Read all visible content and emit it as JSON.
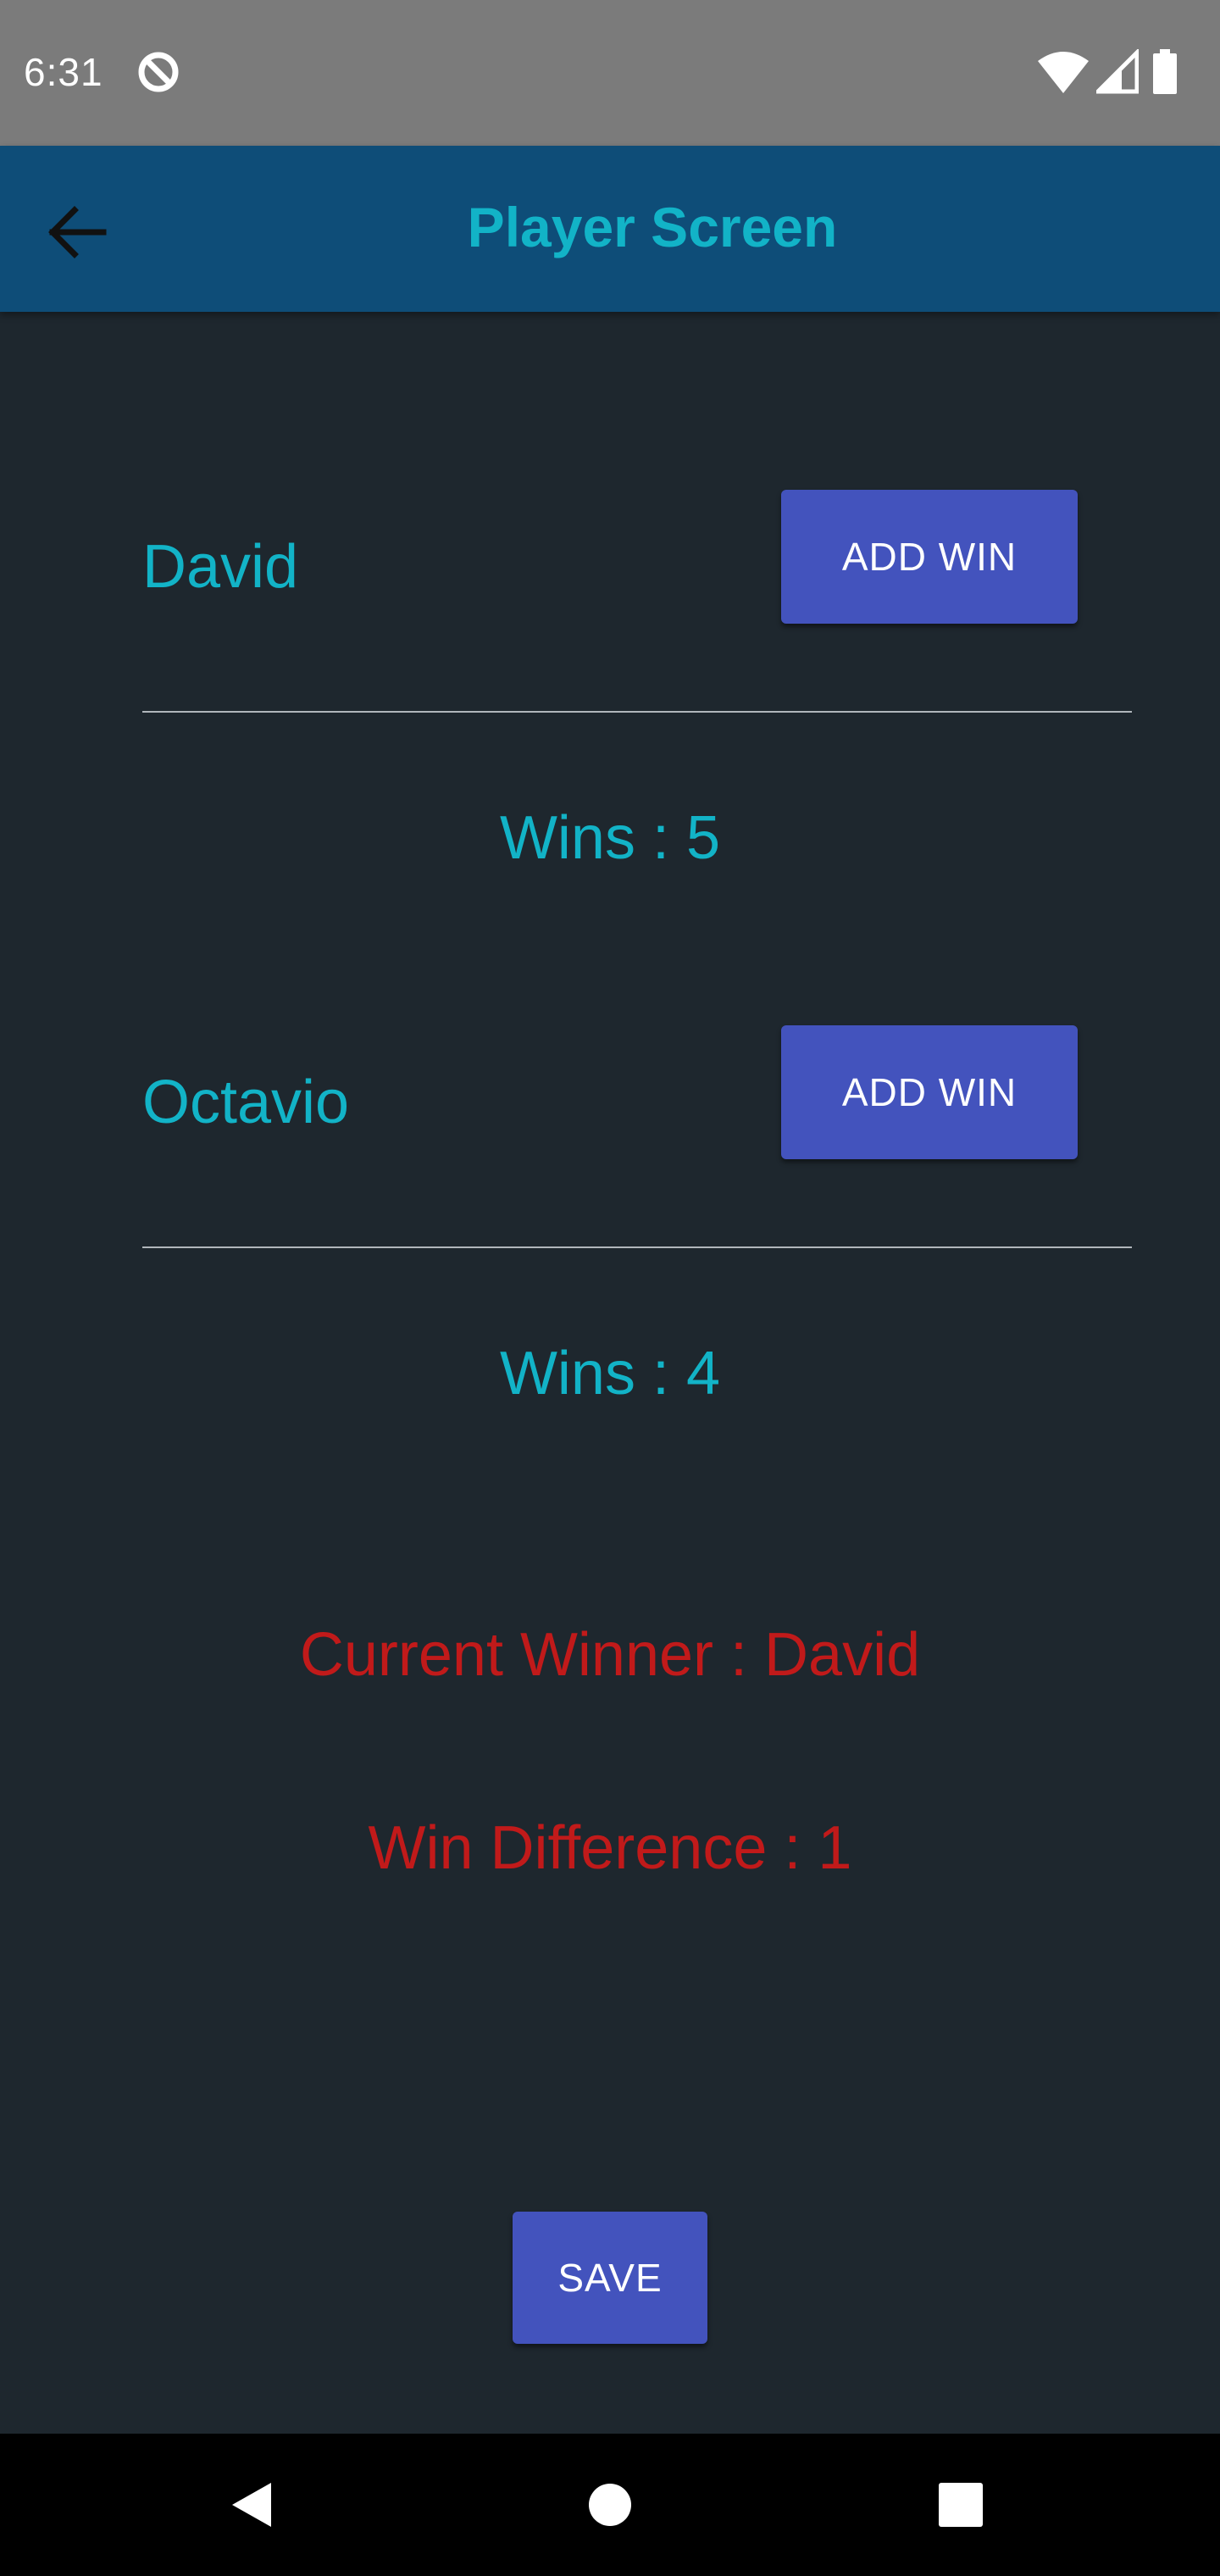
{
  "status_bar": {
    "time": "6:31",
    "icons": [
      "data-saver-icon",
      "wifi-icon",
      "signal-icon",
      "battery-icon"
    ]
  },
  "app_bar": {
    "title": "Player Screen",
    "back_icon": "arrow-back-icon",
    "background": "#0e4d78",
    "title_color": "#12b3c7"
  },
  "players": [
    {
      "name": "David",
      "button_label": "ADD WIN",
      "wins_text": "Wins : 5"
    },
    {
      "name": "Octavio",
      "button_label": "ADD WIN",
      "wins_text": "Wins : 4"
    }
  ],
  "summary": {
    "current_winner": "Current Winner : David",
    "win_difference": "Win Difference : 1",
    "color": "#c11a1a"
  },
  "save_label": "SAVE",
  "nav_bar": {
    "icons": [
      "back-triangle-icon",
      "home-circle-icon",
      "recents-square-icon"
    ]
  },
  "colors": {
    "background": "#1e272e",
    "button": "#4353bd",
    "accent_text": "#12b3c7"
  }
}
